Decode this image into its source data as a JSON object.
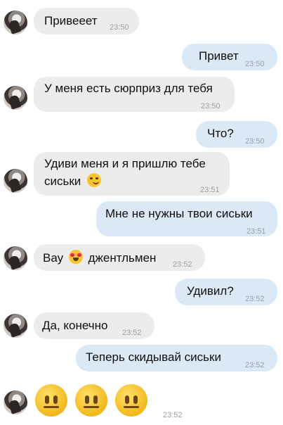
{
  "messages": [
    {
      "text": "Привееет",
      "time": "23:50"
    },
    {
      "text": "Привет",
      "time": "23:50"
    },
    {
      "text": "У меня есть сюрприз для тебя",
      "time": "23:50"
    },
    {
      "text": "Что?",
      "time": "23:50"
    },
    {
      "line1": "Удиви меня и я пришлю тебе",
      "line2": "сиськи",
      "emoji": "smirking-face-icon",
      "time": "23:51"
    },
    {
      "text": "Мне не нужны твои сиськи",
      "time": "23:51"
    },
    {
      "before": "Вау",
      "emoji": "heart-eyes-icon",
      "after": "джентльмен",
      "time": "23:52"
    },
    {
      "text": "Удивил?",
      "time": "23:52"
    },
    {
      "text": "Да, конечно",
      "time": "23:52"
    },
    {
      "text": "Теперь скидывай сиськи",
      "time": "23:52"
    },
    {
      "emoji": "neutral-face-icon",
      "count": 3,
      "time": "23:52"
    }
  ]
}
